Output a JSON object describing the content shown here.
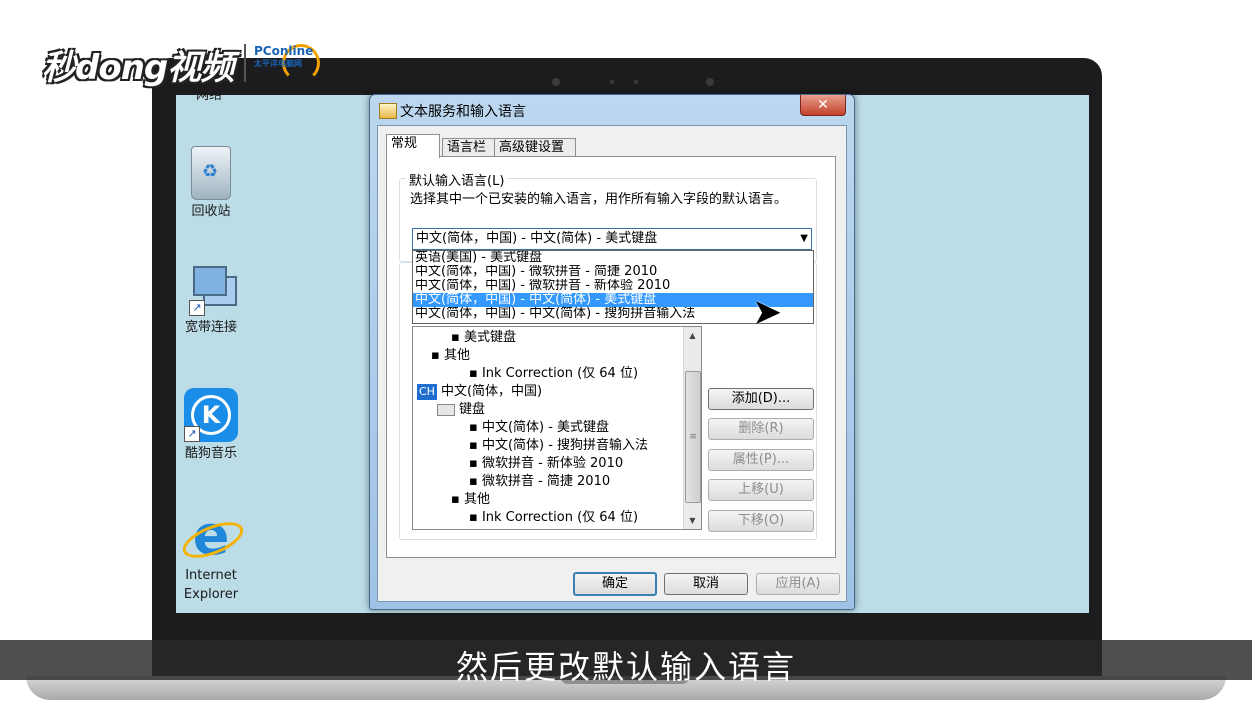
{
  "brand": {
    "logo_text": "秒dong视频",
    "partner_text": "PConline",
    "partner_sub": "太平洋电脑网"
  },
  "subtitle": "然后更改默认输入语言",
  "desktop": {
    "top_partial_label": "网络",
    "icons": [
      {
        "label": "回收站"
      },
      {
        "label": "宽带连接"
      },
      {
        "label": "酷狗音乐"
      },
      {
        "label_line1": "Internet",
        "label_line2": "Explorer"
      }
    ]
  },
  "dialog": {
    "title": "文本服务和输入语言",
    "close": "✕",
    "tabs": [
      "常规",
      "语言栏",
      "高级键设置"
    ],
    "group_default": {
      "title": "默认输入语言(L)",
      "desc": "选择其中一个已安装的输入语言，用作所有输入字段的默认语言。",
      "selected": "中文(简体，中国) - 中文(简体) - 美式键盘",
      "dropdown_items": [
        "英语(美国) - 美式键盘",
        "中文(简体，中国) - 微软拼音 - 简捷 2010",
        "中文(简体，中国) - 微软拼音 - 新体验 2010",
        "中文(简体，中国) - 中文(简体) - 美式键盘",
        "中文(简体，中国) - 中文(简体) - 搜狗拼音输入法"
      ]
    },
    "tree": {
      "rows": [
        "美式键盘",
        "其他",
        "Ink Correction (仅 64 位)",
        "中文(简体，中国)",
        "键盘",
        "中文(简体) - 美式键盘",
        "中文(简体) - 搜狗拼音输入法",
        "微软拼音 - 新体验 2010",
        "微软拼音 - 简捷 2010",
        "其他",
        "Ink Correction (仅 64 位)"
      ],
      "lang_badge": "CH"
    },
    "side_buttons": [
      "添加(D)...",
      "删除(R)",
      "属性(P)...",
      "上移(U)",
      "下移(O)"
    ],
    "footer_buttons": [
      "确定",
      "取消",
      "应用(A)"
    ]
  }
}
